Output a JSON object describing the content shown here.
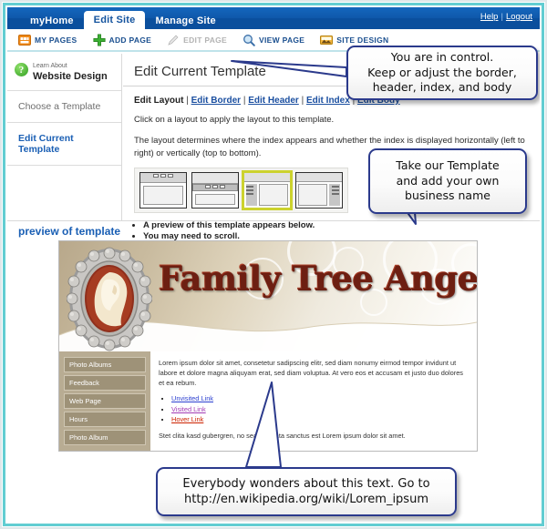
{
  "topbar": {
    "tabs": [
      {
        "label": "myHome",
        "active": false
      },
      {
        "label": "Edit Site",
        "active": true
      },
      {
        "label": "Manage Site",
        "active": false
      }
    ],
    "help_label": "Help",
    "separator": "|",
    "logout_label": "Logout"
  },
  "toolbar": {
    "items": [
      {
        "label": "MY PAGES",
        "icon": "pages-grid-icon",
        "disabled": false
      },
      {
        "label": "ADD PAGE",
        "icon": "plus-icon",
        "disabled": false
      },
      {
        "label": "EDIT PAGE",
        "icon": "pencil-icon",
        "disabled": true
      },
      {
        "label": "VIEW PAGE",
        "icon": "magnifier-icon",
        "disabled": false
      },
      {
        "label": "SITE DESIGN",
        "icon": "palette-image-icon",
        "disabled": false
      }
    ]
  },
  "sidebar": {
    "learn_about_small": "Learn About",
    "learn_about_big": "Website Design",
    "help_icon": "question-mark-icon",
    "items": [
      {
        "label": "Choose a Template",
        "selected": false
      },
      {
        "label": "Edit Current Template",
        "selected": true
      }
    ]
  },
  "main": {
    "page_title": "Edit Current Template",
    "breadcrumb": {
      "current": "Edit Layout",
      "links": [
        "Edit Border",
        "Edit Header",
        "Edit Index",
        "Edit Body"
      ],
      "separator": "|"
    },
    "instruction": "Click on a layout to apply the layout to this template.",
    "description": "The layout determines where the index appears and whether the index is displayed horizontally (left to right) or vertically (top to bottom).",
    "layouts": [
      {
        "name": "layout-top-horizontal-index",
        "selected": false
      },
      {
        "name": "layout-below-header-horizontal-index",
        "selected": false
      },
      {
        "name": "layout-left-vertical-index",
        "selected": true
      },
      {
        "name": "layout-right-vertical-index",
        "selected": false
      }
    ],
    "bullets": [
      "A preview of this template appears below.",
      "You may need to scroll."
    ]
  },
  "preview": {
    "section_label": "preview of template",
    "banner_title": "Family Tree Angels",
    "banner_image": "cameo-brooch-image",
    "index_items": [
      "Photo Albums",
      "Feedback",
      "Web Page",
      "Hours",
      "Photo Album"
    ],
    "paragraph1": "Lorem ipsum dolor sit amet, consetetur sadipscing elitr, sed diam nonumy eirmod tempor invidunt ut labore et dolore magna aliquyam erat, sed diam voluptua. At vero eos et accusam et justo duo dolores et ea rebum.",
    "links": [
      {
        "label": "Unvisited Link",
        "state": "unvisited",
        "color": "#2b3fd0"
      },
      {
        "label": "Visited Link",
        "state": "visited",
        "color": "#a23bb5"
      },
      {
        "label": "Hover Link",
        "state": "hover",
        "color": "#cc2200"
      }
    ],
    "paragraph2": "Stet clita kasd gubergren, no sea takimata sanctus est Lorem ipsum dolor sit amet."
  },
  "callouts": [
    {
      "id": "callout-controls",
      "line1": "You are in control.",
      "line2": "Keep or adjust the border,",
      "line3": "header, index, and body"
    },
    {
      "id": "callout-template-name",
      "line1": "Take our Template",
      "line2": "and add your own",
      "line3": "business name"
    },
    {
      "id": "callout-lorem-ipsum",
      "line1": "Everybody wonders about this text.  Go to",
      "line2": "http://en.wikipedia.org/wiki/Lorem_ipsum"
    }
  ],
  "colors": {
    "topbar_blue": "#0f59ab",
    "frame_teal": "#62cdd2",
    "link_blue": "#1b4fa0",
    "selected_layout_outline": "#ccd22e",
    "callout_border": "#2b3a8c"
  }
}
